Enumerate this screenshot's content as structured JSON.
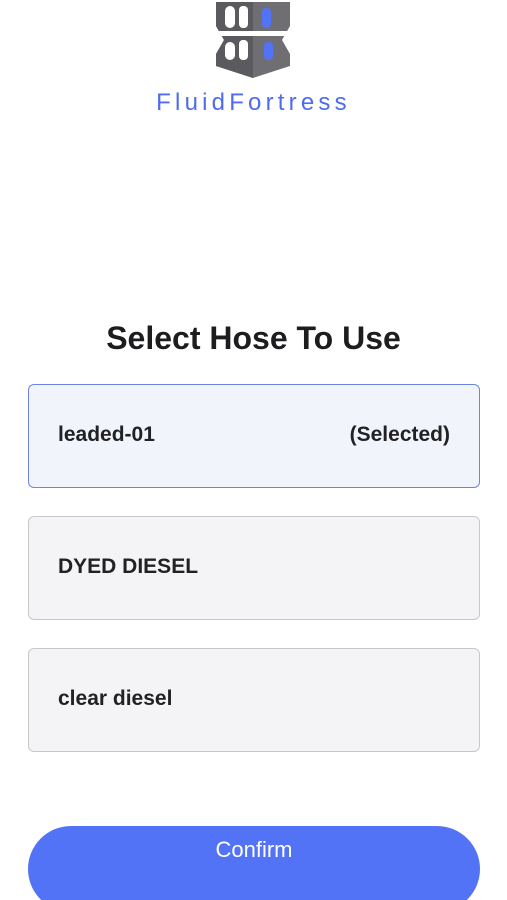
{
  "brand": {
    "name": "FluidFortress",
    "accent_color": "#4f6bf0",
    "logo_icon": "fortress-logo-icon"
  },
  "title": "Select Hose To Use",
  "hoses": [
    {
      "name": "leaded-01",
      "status": "(Selected)",
      "selected": true
    },
    {
      "name": "DYED DIESEL",
      "status": "",
      "selected": false
    },
    {
      "name": "clear diesel",
      "status": "",
      "selected": false
    }
  ],
  "confirm": {
    "label": "Confirm",
    "color": "#5273f5"
  }
}
